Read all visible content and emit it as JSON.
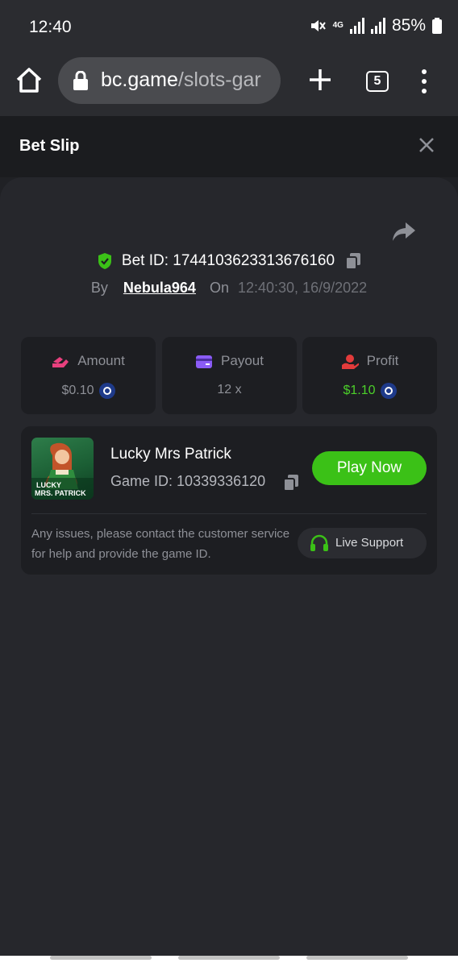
{
  "status_bar": {
    "time": "12:40",
    "network": "4G",
    "battery": "85%"
  },
  "browser": {
    "url_domain": "bc.game",
    "url_path": "/slots-gar",
    "tab_count": "5"
  },
  "bet_slip": {
    "title": "Bet Slip",
    "bet_id_label": "Bet ID:",
    "bet_id": "1744103623313676160",
    "by_label": "By",
    "username": "Nebula964",
    "on_label": "On",
    "datetime": "12:40:30, 16/9/2022"
  },
  "stats": {
    "amount": {
      "label": "Amount",
      "value": "$0.10"
    },
    "payout": {
      "label": "Payout",
      "value": "12 x"
    },
    "profit": {
      "label": "Profit",
      "value": "$1.10"
    }
  },
  "game": {
    "name": "Lucky Mrs Patrick",
    "game_id_label": "Game ID:",
    "game_id": "10339336120",
    "play_label": "Play Now",
    "thumb_text_top": "LUCKY",
    "thumb_text_bottom": "MRS. PATRICK",
    "help_text": "Any issues, please contact the customer service for help and provide the game ID.",
    "support_label": "Live Support"
  },
  "colors": {
    "accent_green": "#3bc117",
    "panel_bg": "#26272c",
    "card_bg": "#1d1e22",
    "amount_icon": "#e8407e",
    "payout_icon": "#8b5cf6",
    "profit_icon": "#e33b3b",
    "profit_value": "#4cd02a"
  },
  "icons": [
    "mute-icon",
    "signal-icon",
    "battery-icon",
    "home-icon",
    "lock-icon",
    "plus-icon",
    "more-vert-icon",
    "close-icon",
    "share-icon",
    "shield-check-icon",
    "copy-icon",
    "coin-icon",
    "headset-icon"
  ]
}
